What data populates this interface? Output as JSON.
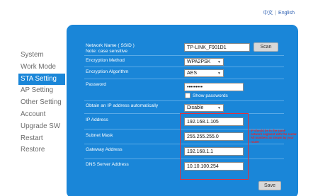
{
  "header": {
    "lang_zh": "中文",
    "lang_sep": "|",
    "lang_en": "English"
  },
  "sidebar": {
    "items": [
      {
        "label": "System"
      },
      {
        "label": "Work Mode"
      },
      {
        "label": "STA Setting"
      },
      {
        "label": "AP Setting"
      },
      {
        "label": "Other Setting"
      },
      {
        "label": "Account"
      },
      {
        "label": "Upgrade SW"
      },
      {
        "label": "Restart"
      },
      {
        "label": "Restore"
      }
    ],
    "active_index": 2
  },
  "form": {
    "ssid_label": "Network Name ( SSID )",
    "ssid_note": "Note: case sensitive",
    "ssid_value": "TP-LINK_F901D1",
    "scan_label": "Scan",
    "encryption_method_label": "Encryption Method",
    "encryption_method_value": "WPA2PSK",
    "encryption_algorithm_label": "Encryption Algorithm",
    "encryption_algorithm_value": "AES",
    "password_label": "Password",
    "password_value": "•••••••••",
    "show_passwords_label": "Show passwords",
    "obtain_ip_label": "Obtain an IP address automatically",
    "obtain_ip_value": "Disable",
    "ip_label": "IP Address",
    "ip_value": "192.168.1.105",
    "mask_label": "Subnet Mask",
    "mask_value": "255.255.255.0",
    "gateway_label": "Gateway Address",
    "gateway_value": "192.168.1.1",
    "dns_label": "DNS Server Address",
    "dns_value": "10.10.100.254",
    "save_label": "Save"
  },
  "annotation": {
    "text": "IP should be in the same network segment with the router. All numbers as shown by your router"
  },
  "colors": {
    "panel": "#1a86d8",
    "highlight": "#e4303a",
    "nav_text": "#6a6a6a",
    "link": "#2a5db0"
  }
}
